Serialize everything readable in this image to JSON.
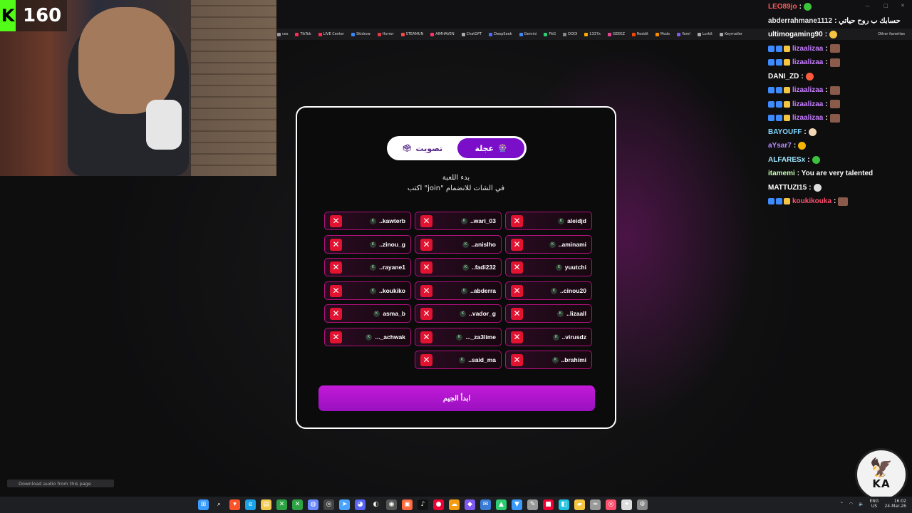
{
  "stream": {
    "viewer_count": "160",
    "kick_letter": "K"
  },
  "browser": {
    "bookmarks": [
      "ces",
      "TikTok",
      "LIVE Center",
      "Skidrow",
      "Horror",
      "STEAMUN",
      "AIMHAVEN",
      "ChatGPT",
      "DeepSeek",
      "Gemini",
      "FitG",
      "DODI",
      "1337x",
      "GEEKZ",
      "Reddit",
      "Mods",
      "Yaml",
      "Lurkit",
      "Keymailer"
    ],
    "other_favorites": "Other favorites"
  },
  "chat": [
    {
      "name": "LEO89jo",
      "name_color": "#ff5a5a",
      "msg": ":",
      "emote": "green"
    },
    {
      "name": "abderrahmane1112",
      "name_color": "#e8e8e8",
      "msg": ": حسابك ب روح حياتي",
      "emote": ""
    },
    {
      "name": "ultimogaming90",
      "name_color": "#ffffff",
      "msg": ":",
      "emote": "wave"
    },
    {
      "name": "lizaalizaa",
      "name_color": "#c77dff",
      "msg": ":",
      "emote": "img",
      "badges": true
    },
    {
      "name": "lizaalizaa",
      "name_color": "#c77dff",
      "msg": ":",
      "emote": "img",
      "badges": true
    },
    {
      "name": "DANI_ZD",
      "name_color": "#ffffff",
      "msg": ":",
      "emote": "face"
    },
    {
      "name": "lizaalizaa",
      "name_color": "#c77dff",
      "msg": ":",
      "emote": "img",
      "badges": true
    },
    {
      "name": "lizaalizaa",
      "name_color": "#c77dff",
      "msg": ":",
      "emote": "img",
      "badges": true
    },
    {
      "name": "lizaalizaa",
      "name_color": "#c77dff",
      "msg": ":",
      "emote": "img",
      "badges": true
    },
    {
      "name": "BAYOUFF",
      "name_color": "#7fd6ff",
      "msg": ":",
      "emote": "cake"
    },
    {
      "name": "aYsar7",
      "name_color": "#b98cff",
      "msg": ":",
      "emote": "multi"
    },
    {
      "name": "ALFARESx",
      "name_color": "#9ee8ff",
      "msg": ":",
      "emote": "green"
    },
    {
      "name": "itamemi",
      "name_color": "#c8ffb0",
      "msg": ": You are very talented",
      "emote": ""
    },
    {
      "name": "MATTUZI15",
      "name_color": "#ffffff",
      "msg": ":",
      "emote": "skull"
    },
    {
      "name": "koukikouka",
      "name_color": "#ff4f6d",
      "msg": ":",
      "emote": "img",
      "badges": true
    }
  ],
  "game": {
    "tabs": [
      {
        "label": "عجلة",
        "icon": "🎡",
        "active": true
      },
      {
        "label": "تصويت",
        "icon": "🗳",
        "active": false
      }
    ],
    "status_line": "بدء اللعبة",
    "instruction_line": "اكتب \"join\" في الشات للانضمام",
    "players": [
      "aleidjd",
      "..wari_03",
      "..kawterb",
      "..aminami",
      "..anislho",
      "..zinou_g",
      "yuutchi",
      "..fadi232",
      "..rayane1",
      "..cinou20",
      "..abderra",
      "..koukiko",
      "..lizaall",
      "..vador_g",
      "asma_b",
      "..virusdz",
      "..._za3lime",
      "..._achwak",
      "..brahimi",
      "..said_ma",
      ""
    ],
    "start_button": "ابدأ الجيم"
  },
  "overlay": {
    "download_text": "Download audio from this page",
    "logo_text": "KA"
  },
  "taskbar": {
    "lang_top": "ENG",
    "lang_bottom": "US",
    "time": "16:02",
    "date": "24-Mar-26"
  },
  "colors": {
    "accent_purple": "#7b0fc9",
    "remove_red": "#e11330",
    "player_border": "#b0107a",
    "start_gradient_top": "#c21ad8",
    "kick_green": "#53fc18"
  }
}
